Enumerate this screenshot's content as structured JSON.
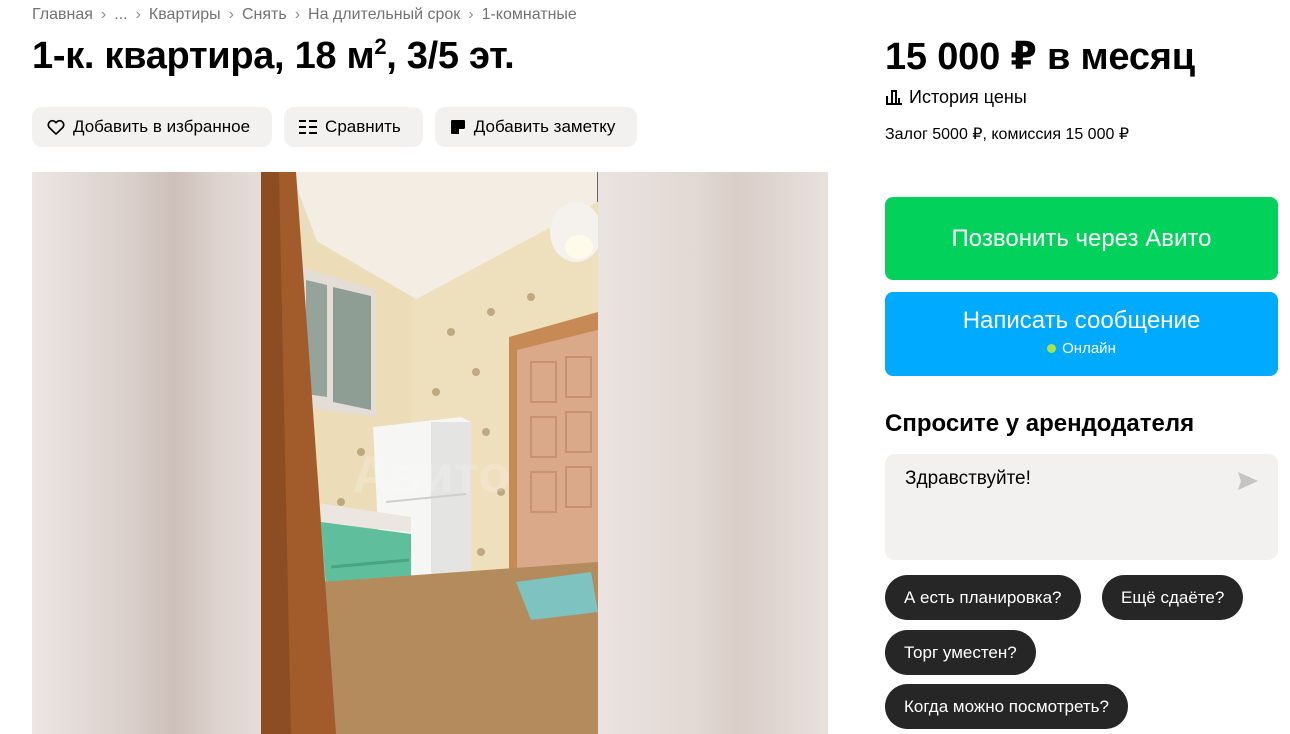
{
  "breadcrumb": {
    "items": [
      "Главная",
      "...",
      "Квартиры",
      "Снять",
      "На длительный срок",
      "1-комнатные"
    ],
    "separator": "›"
  },
  "listing": {
    "title_main": "1-к. квартира, 18 м",
    "title_sup": "2",
    "title_tail": ", 3/5 эт."
  },
  "actions": {
    "favorite_label": "Добавить в избранное",
    "compare_label": "Сравнить",
    "note_label": "Добавить заметку"
  },
  "gallery": {
    "image": "apartment-photo-hallway-kitchen"
  },
  "pricing": {
    "price": "15 000 ₽ в месяц",
    "history_label": "История цены",
    "deposit_text": "Залог 5000 ₽, комиссия 15 000 ₽"
  },
  "contact": {
    "call_label": "Позвонить через Авито",
    "message_label": "Написать сообщение",
    "online_label": "Онлайн"
  },
  "ask": {
    "title": "Спросите у арендодателя",
    "input_value": "Здравствуйте!",
    "chips": [
      "А есть планировка?",
      "Ещё сдаёте?",
      "Торг уместен?",
      "Когда можно посмотреть?"
    ]
  },
  "colors": {
    "call_button": "#02d15c",
    "message_button": "#00aaff",
    "chip_bg": "#262626",
    "secondary_bg": "#f2f1f0",
    "online_dot": "#a6e34f"
  }
}
